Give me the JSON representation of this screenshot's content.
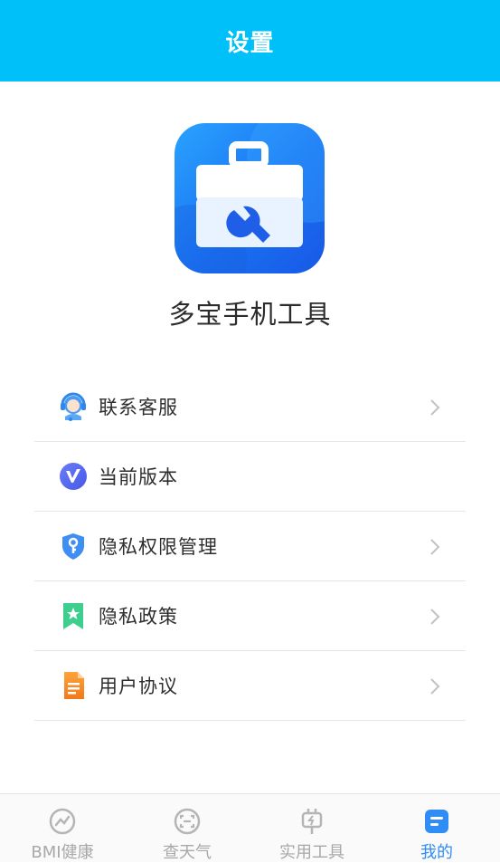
{
  "header": {
    "title": "设置"
  },
  "app": {
    "name": "多宝手机工具",
    "icon": "toolbox-wrench-icon"
  },
  "menu": [
    {
      "label": "联系客服",
      "icon": "customer-service-icon",
      "chevron": true
    },
    {
      "label": "当前版本",
      "icon": "version-v-icon",
      "chevron": false
    },
    {
      "label": "隐私权限管理",
      "icon": "shield-key-icon",
      "chevron": true
    },
    {
      "label": "隐私政策",
      "icon": "bookmark-star-icon",
      "chevron": true
    },
    {
      "label": "用户协议",
      "icon": "document-icon",
      "chevron": true
    }
  ],
  "tabs": [
    {
      "label": "BMI健康",
      "icon": "health-chart-icon",
      "active": false
    },
    {
      "label": "查天气",
      "icon": "weather-icon",
      "active": false
    },
    {
      "label": "实用工具",
      "icon": "plug-icon",
      "active": false
    },
    {
      "label": "我的",
      "icon": "profile-card-icon",
      "active": true
    }
  ],
  "colors": {
    "header": "#00c0fa",
    "active_tab": "#2f8df5",
    "inactive_tab": "#a8a8a8"
  }
}
